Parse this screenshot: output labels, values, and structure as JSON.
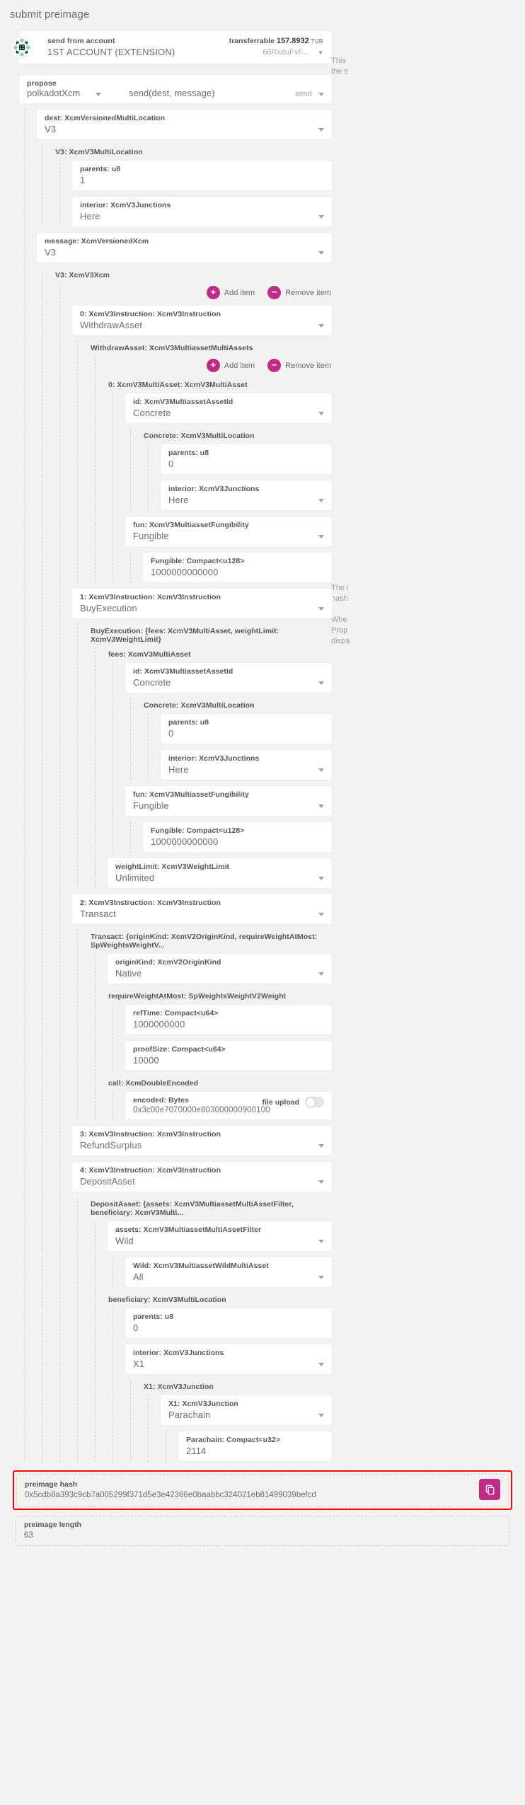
{
  "modal": {
    "title": "submit preimage"
  },
  "account": {
    "label": "send from account",
    "value": "1ST ACCOUNT (EXTENSION)",
    "balance_label": "transferrable",
    "balance_amount": "157.8932",
    "balance_unit": "TUR",
    "address": "66RxduFvF...",
    "icon": "identicon"
  },
  "help": {
    "top": "This\nthe s",
    "mid": "The i\nhash\n\nWhe\nProp\ndispa"
  },
  "propose": {
    "label": "propose",
    "module": "polkadotXcm",
    "method": "send(dest, message)",
    "side_label": "send"
  },
  "fields": {
    "dest": {
      "label": "dest: XcmVersionedMultiLocation",
      "value": "V3"
    },
    "dest_v3_group": "V3: XcmV3MultiLocation",
    "dest_parents": {
      "label": "parents: u8",
      "value": "1"
    },
    "dest_interior": {
      "label": "interior: XcmV3Junctions",
      "value": "Here"
    },
    "message": {
      "label": "message: XcmVersionedXcm",
      "value": "V3"
    },
    "message_v3_group": "V3: XcmV3Xcm",
    "instr0": {
      "label": "0: XcmV3Instruction: XcmV3Instruction",
      "value": "WithdrawAsset"
    },
    "withdraw_group": "WithdrawAsset: XcmV3MultiassetMultiAssets",
    "asset0_group": "0: XcmV3MultiAsset: XcmV3MultiAsset",
    "w_id": {
      "label": "id: XcmV3MultiassetAssetId",
      "value": "Concrete"
    },
    "w_concrete_group": "Concrete: XcmV3MultiLocation",
    "w_parents": {
      "label": "parents: u8",
      "value": "0"
    },
    "w_interior": {
      "label": "interior: XcmV3Junctions",
      "value": "Here"
    },
    "w_fun": {
      "label": "fun: XcmV3MultiassetFungibility",
      "value": "Fungible"
    },
    "w_fungible": {
      "label": "Fungible: Compact<u128>",
      "value": "1000000000000"
    },
    "instr1": {
      "label": "1: XcmV3Instruction: XcmV3Instruction",
      "value": "BuyExecution"
    },
    "buy_group": "BuyExecution: {fees: XcmV3MultiAsset, weightLimit: XcmV3WeightLimit}",
    "fees_group": "fees: XcmV3MultiAsset",
    "b_id": {
      "label": "id: XcmV3MultiassetAssetId",
      "value": "Concrete"
    },
    "b_concrete_group": "Concrete: XcmV3MultiLocation",
    "b_parents": {
      "label": "parents: u8",
      "value": "0"
    },
    "b_interior": {
      "label": "interior: XcmV3Junctions",
      "value": "Here"
    },
    "b_fun": {
      "label": "fun: XcmV3MultiassetFungibility",
      "value": "Fungible"
    },
    "b_fungible": {
      "label": "Fungible: Compact<u128>",
      "value": "1000000000000"
    },
    "b_weightlimit": {
      "label": "weightLimit: XcmV3WeightLimit",
      "value": "Unlimited"
    },
    "instr2": {
      "label": "2: XcmV3Instruction: XcmV3Instruction",
      "value": "Transact"
    },
    "transact_group": "Transact: {originKind: XcmV2OriginKind, requireWeightAtMost: SpWeightsWeightV...",
    "t_originkind": {
      "label": "originKind: XcmV2OriginKind",
      "value": "Native"
    },
    "t_rwam_group": "requireWeightAtMost: SpWeightsWeightV2Weight",
    "t_reftime": {
      "label": "refTime: Compact<u64>",
      "value": "1000000000"
    },
    "t_proofsize": {
      "label": "proofSize: Compact<u64>",
      "value": "10000"
    },
    "t_call_group": "call: XcmDoubleEncoded",
    "t_encoded": {
      "label": "encoded: Bytes",
      "value": "0x3c00e7070000e803000000900100"
    },
    "t_fileupload": "file upload",
    "instr3": {
      "label": "3: XcmV3Instruction: XcmV3Instruction",
      "value": "RefundSurplus"
    },
    "instr4": {
      "label": "4: XcmV3Instruction: XcmV3Instruction",
      "value": "DepositAsset"
    },
    "deposit_group": "DepositAsset: {assets: XcmV3MultiassetMultiAssetFilter, beneficiary: XcmV3Multi...",
    "d_assets": {
      "label": "assets: XcmV3MultiassetMultiAssetFilter",
      "value": "Wild"
    },
    "d_wild_group": "Wild: XcmV3MultiassetWildMultiAsset",
    "d_wild_all": {
      "label": "Wild: XcmV3MultiassetWildMultiAsset",
      "value": "All"
    },
    "d_beneficiary_group": "beneficiary: XcmV3MultiLocation",
    "d_parents": {
      "label": "parents: u8",
      "value": "0"
    },
    "d_interior": {
      "label": "interior: XcmV3Junctions",
      "value": "X1"
    },
    "d_x1_group": "X1: XcmV3Junction",
    "d_x1": {
      "label": "X1: XcmV3Junction",
      "value": "Parachain"
    },
    "d_parachain": {
      "label": "Parachain: Compact<u32>",
      "value": "2114"
    }
  },
  "buttons": {
    "add_item": "Add item",
    "remove_item": "Remove item",
    "plus": "+",
    "minus": "−"
  },
  "preimage": {
    "hash_label": "preimage hash",
    "hash_value": "0x5cdb8a393c9cb7a005299f371d5e3e42366e0baabbc324021eb81499039befcd",
    "length_label": "preimage length",
    "length_value": "63",
    "highlight_color": "#ff0000",
    "copy_icon": "copy-icon",
    "accent": "#c12a86"
  }
}
